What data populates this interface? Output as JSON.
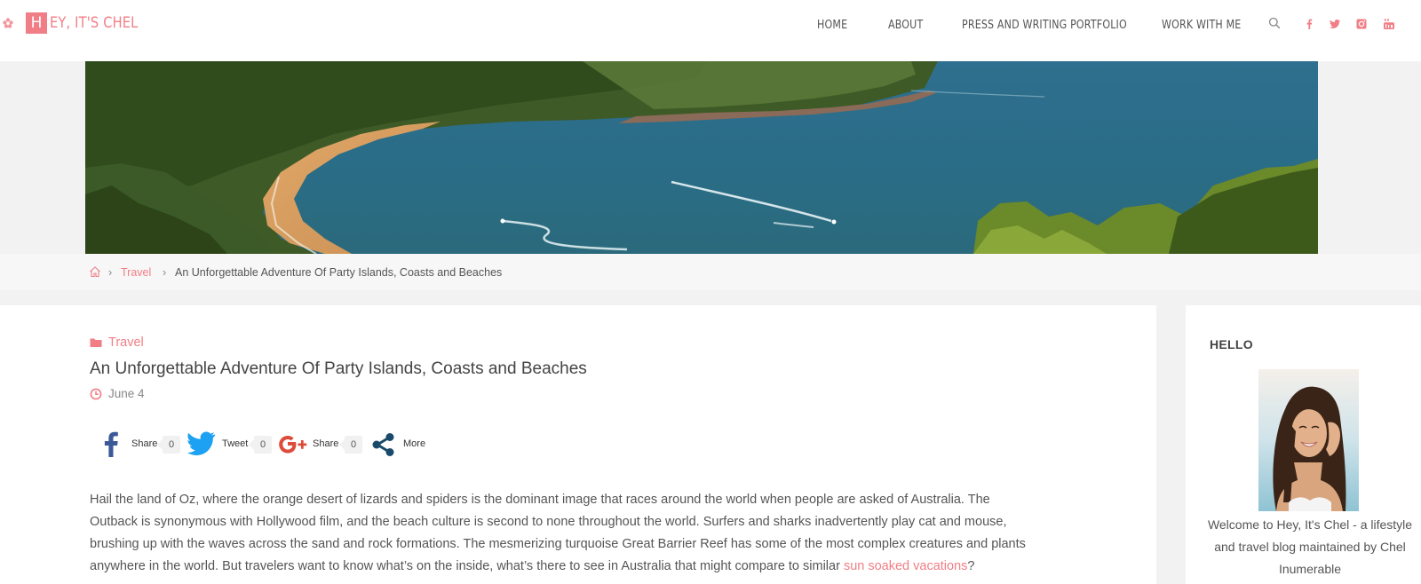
{
  "header": {
    "logo_first": "H",
    "logo_rest": "EY, IT'S CHEL",
    "nav": [
      "HOME",
      "ABOUT",
      "PRESS AND WRITING PORTFOLIO",
      "WORK WITH ME"
    ],
    "social_icons": [
      "facebook-icon",
      "twitter-icon",
      "instagram-icon",
      "youtube-icon"
    ]
  },
  "breadcrumb": {
    "home_icon": "home-icon",
    "category": "Travel",
    "current": "An Unforgettable Adventure Of Party Islands, Coasts and Beaches"
  },
  "post": {
    "category": "Travel",
    "title": "An Unforgettable Adventure Of Party Islands, Coasts and Beaches",
    "date": "June 4",
    "share": [
      {
        "network": "facebook",
        "label": "Share",
        "count": "0"
      },
      {
        "network": "twitter",
        "label": "Tweet",
        "count": "0"
      },
      {
        "network": "google-plus",
        "label": "Share",
        "count": "0"
      },
      {
        "network": "more",
        "label": "More"
      }
    ],
    "body_lines": [
      "Hail the land of Oz, where the orange desert of lizards and spiders is the dominant image that races around the world when people are asked of Australia. The",
      "Outback is synonymous with Hollywood film, and the beach culture is second to none throughout the world. Surfers and sharks inadvertently play cat and mouse,",
      "brushing up with the waves across the sand and rock formations. The mesmerizing turquoise Great Barrier Reef has some of the most complex creatures and plants"
    ],
    "body_last_before": "anywhere in the world. But travelers want to know what’s on the inside, what’s there to see in Australia that might compare to similar ",
    "body_link": "sun soaked vacations",
    "body_last_after": "?"
  },
  "sidebar": {
    "title": "HELLO",
    "text": "Welcome to Hey, It's Chel - a lifestyle and travel blog maintained by Chel Inumerable"
  },
  "colors": {
    "accent": "#f17e86",
    "facebook": "#3b5998",
    "twitter": "#1da1f2",
    "google": "#dd4b39",
    "more": "#1a4a6b"
  }
}
